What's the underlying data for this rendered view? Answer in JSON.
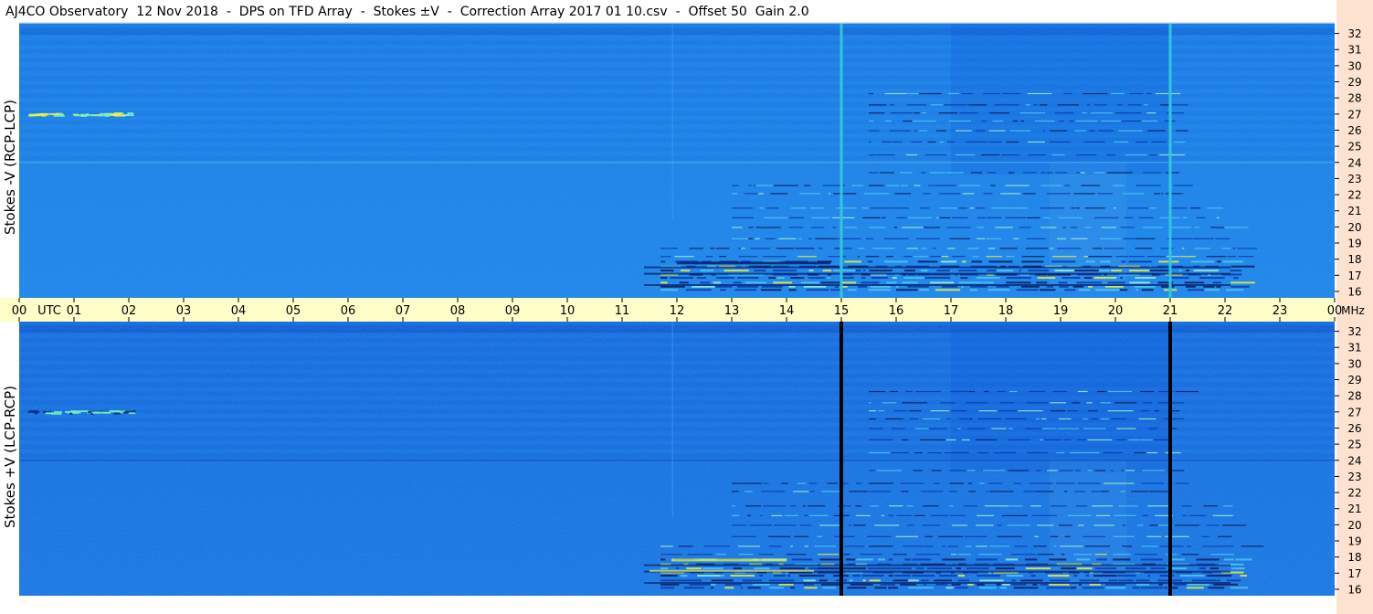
{
  "title": "AJ4CO Observatory  12 Nov 2018  -  DPS on TFD Array  -  Stokes ±V  -  Correction Array 2017 01 10.csv  -  Offset 50  Gain 2.0",
  "colors": {
    "panel_base": "#1e82e8",
    "panel_dark": "#1060d8",
    "time_axis_bg": "#fffdc8",
    "mhz_axis_bg": "#fde3cf",
    "spike": "#30c8d8",
    "black_line": "#000000"
  },
  "chart_data": [
    {
      "type": "heatmap",
      "panel": "top",
      "ylabel": "Stokes -V (RCP-LCP)",
      "x_unit": "UTC",
      "x_ticks": [
        "00",
        "01",
        "02",
        "03",
        "04",
        "05",
        "06",
        "07",
        "08",
        "09",
        "10",
        "11",
        "12",
        "13",
        "14",
        "15",
        "16",
        "17",
        "18",
        "19",
        "20",
        "21",
        "22",
        "23",
        "00"
      ],
      "xlim": [
        0,
        24
      ],
      "y_unit": "MHz",
      "y_ticks": [
        16,
        17,
        18,
        19,
        20,
        21,
        22,
        23,
        24,
        25,
        26,
        27,
        28,
        29,
        30,
        31,
        32
      ],
      "ylim": [
        15.6,
        32.6
      ],
      "vertical_lines": [
        {
          "x": 15,
          "kind": "spike"
        },
        {
          "x": 21,
          "kind": "spike"
        }
      ],
      "horizontal_lines": [
        24
      ]
    },
    {
      "type": "heatmap",
      "panel": "bottom",
      "ylabel": "Stokes +V (LCP-RCP)",
      "x_unit": "UTC",
      "x_ticks": [
        "00",
        "01",
        "02",
        "03",
        "04",
        "05",
        "06",
        "07",
        "08",
        "09",
        "10",
        "11",
        "12",
        "13",
        "14",
        "15",
        "16",
        "17",
        "18",
        "19",
        "20",
        "21",
        "22",
        "23",
        "00"
      ],
      "xlim": [
        0,
        24
      ],
      "y_unit": "MHz",
      "y_ticks": [
        16,
        17,
        18,
        19,
        20,
        21,
        22,
        23,
        24,
        25,
        26,
        27,
        28,
        29,
        30,
        31,
        32
      ],
      "ylim": [
        15.6,
        32.6
      ],
      "vertical_lines": [
        {
          "x": 15,
          "kind": "gap"
        },
        {
          "x": 21,
          "kind": "gap"
        }
      ],
      "horizontal_lines": [
        24
      ]
    }
  ],
  "axis": {
    "utc_label": "UTC",
    "mhz_label": "MHz"
  }
}
